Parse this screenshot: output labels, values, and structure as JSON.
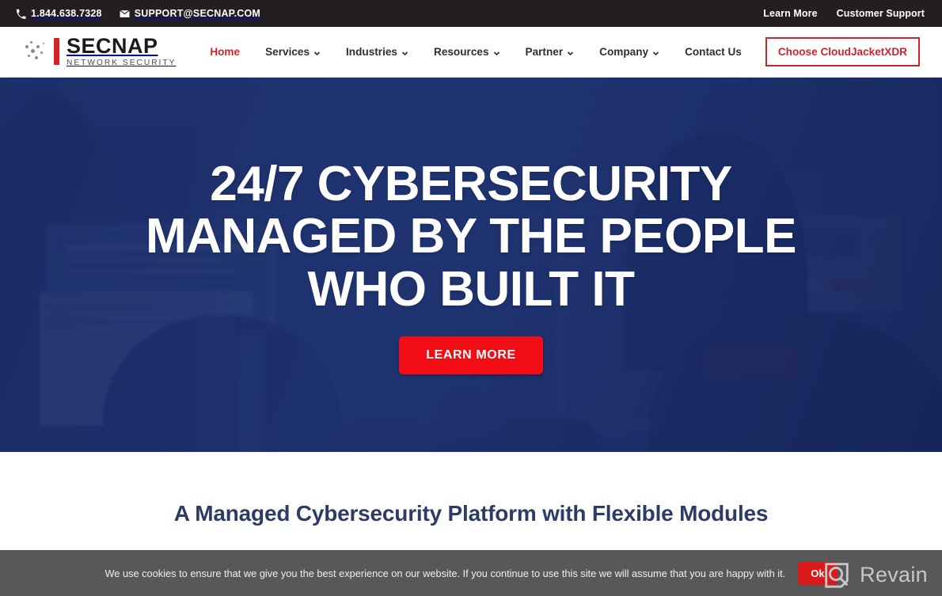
{
  "topbar": {
    "phone": "1.844.638.7328",
    "phone_icon": "phone-icon",
    "email": "SUPPORT@SECNAP.COM",
    "email_icon": "envelope-icon",
    "links": [
      {
        "label": "Learn More"
      },
      {
        "label": "Customer Support"
      }
    ],
    "background": "#231f20",
    "text_color": "#ffffff"
  },
  "header": {
    "logo": {
      "name": "SECNAP",
      "trademark": "®",
      "tagline": "NETWORK SECURITY",
      "bar_color": "#d81f26",
      "name_color": "#1a1a1a"
    },
    "nav": [
      {
        "label": "Home",
        "has_dropdown": false,
        "active": true
      },
      {
        "label": "Services",
        "has_dropdown": true,
        "active": false
      },
      {
        "label": "Industries",
        "has_dropdown": true,
        "active": false
      },
      {
        "label": "Resources",
        "has_dropdown": true,
        "active": false
      },
      {
        "label": "Partner",
        "has_dropdown": true,
        "active": false
      },
      {
        "label": "Company",
        "has_dropdown": true,
        "active": false
      },
      {
        "label": "Contact Us",
        "has_dropdown": false,
        "active": false
      }
    ],
    "cta": {
      "label": "Choose CloudJacketXDR",
      "color": "#c9252d"
    },
    "active_color": "#c9252d",
    "chevron_icon": "chevron-down-icon"
  },
  "hero": {
    "title_line1": "24/7 CYBERSECURITY",
    "title_line2": "MANAGED BY THE PEOPLE",
    "title_line3": "WHO BUILT IT",
    "button_label": "LEARN MORE",
    "button_color": "#f20d14",
    "overlay_color": "#1d3068",
    "text_color": "#ffffff"
  },
  "section": {
    "heading": "A Managed Cybersecurity Platform with Flexible Modules",
    "heading_color": "#2c3c64"
  },
  "cookie_bar": {
    "message": "We use cookies to ensure that we give you the best experience on our website. If you continue to use this site we will assume that you are happy with it.",
    "accept_label": "Ok",
    "background": "#585858",
    "accept_color": "#da1a1a"
  },
  "watermark": {
    "name": "Revain",
    "icon": "revain-logo-icon",
    "color": "#c7c7c7"
  }
}
